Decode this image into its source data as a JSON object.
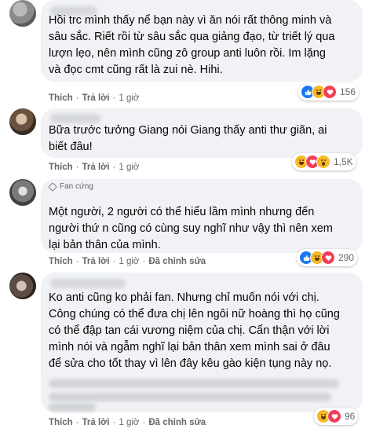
{
  "comments": [
    {
      "badge": "",
      "text": "Hồi trc mình thấy nể bạn này vì ăn nói rất thông minh và\nsâu sắc. Riết rồi từ sâu sắc qua giảng đạo, từ triết lý qua\nlượn lẹo, nên mình cũng zô group anti luôn rồi. Im lặng\nvà đọc cmt cũng rất là zui nè. Hihi.",
      "like": "Thích",
      "reply": "Trả lời",
      "time": "1 giờ",
      "edit": "",
      "reaction_count": "156",
      "reactions": [
        "like-icon",
        "haha-icon",
        "love-icon"
      ]
    },
    {
      "badge": "",
      "text": "Bữa trước tưởng Giang nói Giang thấy anti thư giãn, ai\nbiết đâu!",
      "like": "Thích",
      "reply": "Trả lời",
      "time": "1 giờ",
      "edit": "",
      "reaction_count": "1,5K",
      "reactions": [
        "haha-icon",
        "love-icon",
        "wow-icon"
      ]
    },
    {
      "badge": "Fan cứng",
      "text": "Một người, 2 người có thể hiểu lầm mình nhưng đến\nngười thứ n cũng có cùng suy nghĩ như vậy thì nên xem\nlại bản thân của mình.",
      "like": "Thích",
      "reply": "Trả lời",
      "time": "1 giờ",
      "edit": "Đã chỉnh sửa",
      "reaction_count": "290",
      "reactions": [
        "like-icon",
        "haha-icon",
        "love-icon"
      ]
    },
    {
      "badge": "",
      "text": "Ko anti cũng ko phải fan. Nhưng chỉ muốn nói với chị.\nCông chúng có thể đưa chị lên ngôi nữ hoàng thì họ cũng\ncó thể đập tan cái vương niệm của chị. Cẩn thận với lời\nmình nói và ngẫm nghĩ lại bản thân xem mình sai ở đâu\nđể sửa cho tốt thay vì lên đây kêu gào kiện tụng này nọ.",
      "like": "Thích",
      "reply": "Trả lời",
      "time": "1 giờ",
      "edit": "Đã chỉnh sửa",
      "reaction_count": "96",
      "reactions": [
        "haha-icon",
        "love-icon"
      ]
    }
  ]
}
